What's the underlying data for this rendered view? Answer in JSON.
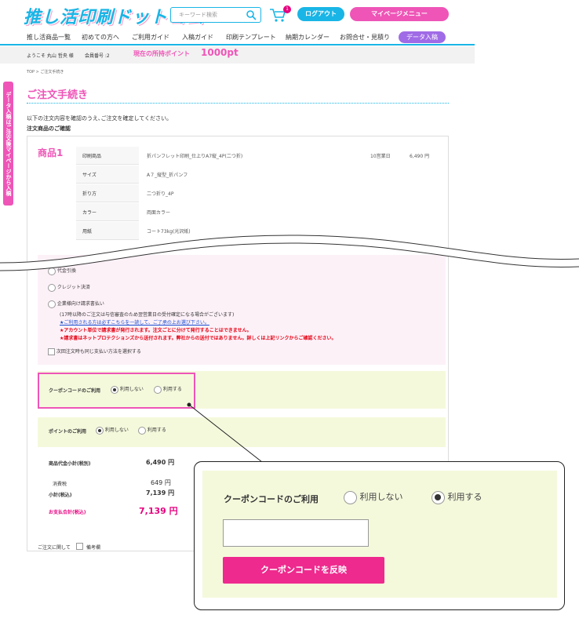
{
  "header": {
    "logo": "推し活印刷ドットコム",
    "search_placeholder": "キーワード検索",
    "cart_count": "1",
    "login": "ログアウト",
    "mypage": "マイページメニュー"
  },
  "nav": [
    "推し活商品一覧",
    "初めての方へ",
    "ご利用ガイド",
    "入稿ガイド",
    "印刷テンプレート",
    "納期カレンダー",
    "お問合せ・見積り",
    "データ入稿"
  ],
  "subbar": {
    "welcome": "ようこそ 丸山 哲央 様",
    "member": "会員番号 :2",
    "points_label": "現在の所持ポイント",
    "points": "1000pt"
  },
  "side_tab": "データ入稿はご注文後マイページから入稿",
  "breadcrumb": "TOP > ご注文手続き",
  "title": "ご注文手続き",
  "intro": "以下の注文内容を確認のうえ､ご注文を確定してください。",
  "section": "注文商品のご確認",
  "product_label": "商品1",
  "rows": [
    {
      "k": "印刷商品",
      "v": "折パンフレット印刷_仕上りA7縦_4P(二つ折)",
      "d": "10営業日",
      "p": "6,490 円"
    },
    {
      "k": "サイズ",
      "v": "A７_縦型_折パンフ",
      "d": "",
      "p": ""
    },
    {
      "k": "折り方",
      "v": "二つ折り_4P",
      "d": "",
      "p": ""
    },
    {
      "k": "カラー",
      "v": "両面カラー",
      "d": "",
      "p": ""
    },
    {
      "k": "用紙",
      "v": "コート73kg(光沢紙)",
      "d": "",
      "p": ""
    }
  ],
  "payment": {
    "opt1": "代金引換",
    "opt2": "クレジット決済",
    "opt3": "企業様向け請求書払い",
    "note1": "(17時以降のご注文は与信審査のため翌営業日の受付確定になる場合がございます)",
    "note2": "★ご利用される方は必ずこちらを一読して、ご了承の上お選び下さい。",
    "note3": "★アカウント単位で請求書が発行されます。注文ごとに分けて発行することはできません。",
    "note4": "★請求書はネットプロテクションズから送付されます。弊社からの送付ではありません。詳しくは上記リンクからご確認ください。",
    "next": "次回注文時も同じ支払い方法を選択する"
  },
  "coupon": {
    "label": "クーポンコードのご利用",
    "no": "利用しない",
    "yes": "利用する"
  },
  "point": {
    "label": "ポイントのご利用",
    "no": "利用しない",
    "yes": "利用する"
  },
  "summary": {
    "subtotal_label": "商品代金小計(税別)",
    "subtotal": "6,490 円",
    "tax_label": "消費税",
    "tax": "649 円",
    "total_label": "小計(税込)",
    "total": "7,139 円",
    "pay_label": "お支払合計(税込)",
    "pay": "7,139 円"
  },
  "remarks": "ご注文に関して",
  "remarks_box": "備考欄",
  "zoom": {
    "label": "クーポンコードのご利用",
    "no": "利用しない",
    "yes": "利用する",
    "button": "クーポンコードを反映"
  }
}
